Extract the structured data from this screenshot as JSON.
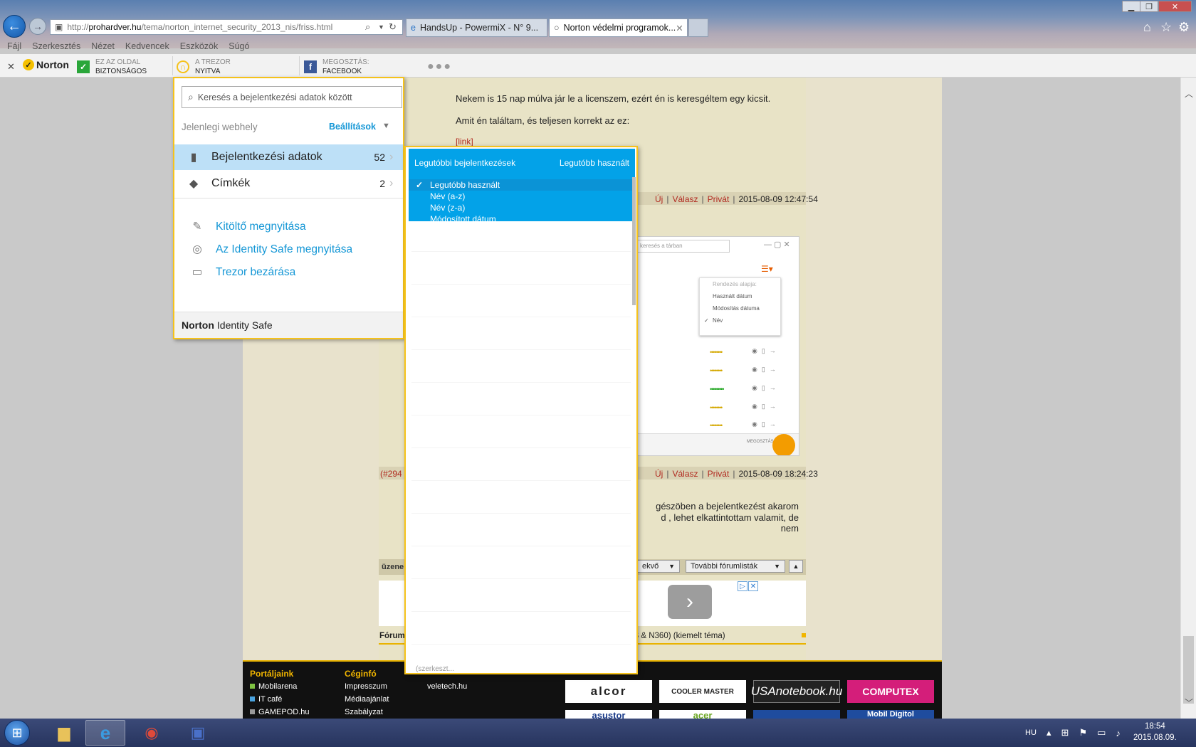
{
  "browser": {
    "address": {
      "scheme": "http://",
      "host": "prohardver.hu",
      "path": "/tema/norton_internet_security_2013_nis/friss.html"
    },
    "tabs": [
      {
        "label": "HandsUp - PowermiX - N° 9...",
        "icon": "ie-icon"
      },
      {
        "label": "Norton védelmi programok...",
        "icon": "page-icon",
        "active": true
      }
    ],
    "menu": [
      "Fájl",
      "Szerkesztés",
      "Nézet",
      "Kedvencek",
      "Eszközök",
      "Súgó"
    ]
  },
  "norton_toolbar": {
    "brand": "Norton",
    "safe_small": "EZ AZ OLDAL",
    "safe_big": "BIZTONSÁGOS",
    "vault_small": "A TREZOR",
    "vault_big": "NYITVA",
    "share_small": "MEGOSZTÁS:",
    "share_big": "FACEBOOK",
    "more": "●●●"
  },
  "page": {
    "post1_line1": "Nekem is 15 nap múlva jár le a licenszem, ezért én is keresgéltem egy kicsit.",
    "post1_line2": "Amit én találtam, és teljesen korrekt az ez:",
    "post1_link": "[link]",
    "meta1": {
      "new": "Új",
      "reply": "Válasz",
      "private": "Privát",
      "date": "2015-08-09 12:47:54"
    },
    "meta2": {
      "ref": "(#294",
      "new": "Új",
      "reply": "Válasz",
      "private": "Privát",
      "date": "2015-08-09 18:24:23"
    },
    "post2_line1": "gészöben a bejelentkezést akarom",
    "post2_line2": "d , lehet elkattintottam valamit, de nem",
    "forum_label": "üzene",
    "select1": "ekvő",
    "select2": "További fórumlisták",
    "forum_link_prefix": "Fórum",
    "forum_link_rest": "NIS & N360) (kiemelt téma)",
    "shot": {
      "search": "keresés a tárban",
      "menu": [
        "Rendezés alapja:",
        "Használt dátum",
        "Módosítás dátuma",
        "Név"
      ],
      "share": "MEGOSZTÁS"
    }
  },
  "footer": {
    "col1_head": "Portáljaink",
    "col1": [
      "Mobilarena",
      "IT café",
      "GAMEPOD.hu"
    ],
    "col2_head": "Céginfó",
    "col2": [
      "Impresszum",
      "Médiaajánlat",
      "Szabályzat"
    ],
    "col3": [
      "veletech.hu"
    ],
    "logos": [
      "alcor",
      "COOLER MASTER",
      "USAnotebook.hu",
      "COMPUTEX",
      "asustor",
      "acer",
      "",
      "Mobil Digitol"
    ]
  },
  "identity_safe": {
    "search_placeholder": "Keresés a bejelentkezési adatok között",
    "current_site": "Jelenlegi webhely",
    "settings": "Beállítások",
    "items": [
      {
        "label": "Bejelentkezési adatok",
        "count": "52",
        "icon": "card-icon"
      },
      {
        "label": "Címkék",
        "count": "2",
        "icon": "tag-icon"
      }
    ],
    "links": [
      {
        "label": "Kitöltő megnyitása",
        "icon": "pen-icon"
      },
      {
        "label": "Az Identity Safe megnyitása",
        "icon": "fingerprint-icon"
      },
      {
        "label": "Trezor bezárása",
        "icon": "vault-icon"
      }
    ],
    "footer_bold": "Norton",
    "footer_rest": "Identity Safe"
  },
  "sort_dropdown": {
    "title": "Legutóbbi bejelentkezések",
    "current": "Legutóbb használt",
    "options": [
      "Legutóbb használt",
      "Név (a-z)",
      "Név (z-a)",
      "Módosított dátum"
    ],
    "bottom": "(szerkeszt..."
  },
  "taskbar": {
    "lang": "HU",
    "time": "18:54",
    "date": "2015.08.09."
  },
  "colors": {
    "norton_yellow": "#f5c21b",
    "accent_blue": "#03a2e8",
    "link_blue": "#1597d6",
    "forum_red": "#b1291f"
  }
}
